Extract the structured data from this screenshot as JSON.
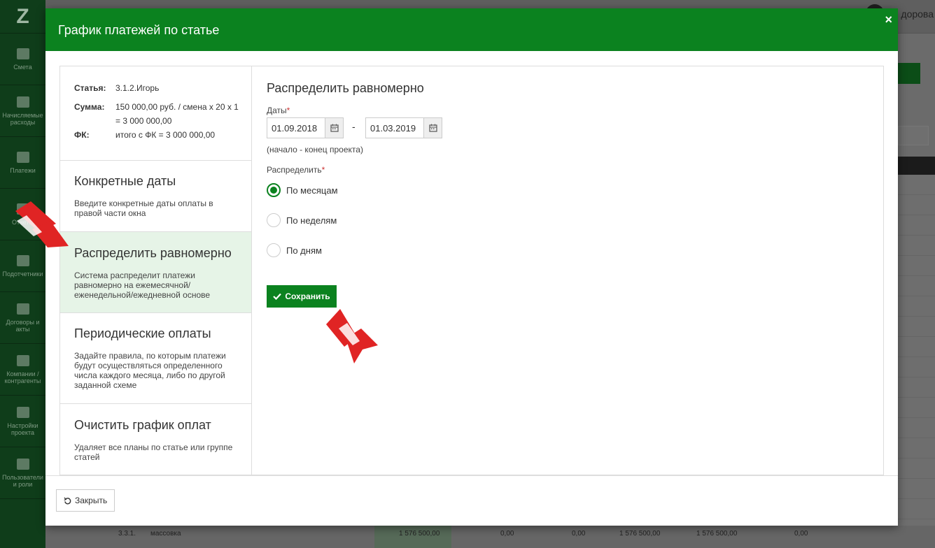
{
  "background": {
    "logo": "Z",
    "sidebar_items": [
      {
        "label": "Смета"
      },
      {
        "label": "Начисляемые расходы"
      },
      {
        "label": "Платежи"
      },
      {
        "label": "Отчеты"
      },
      {
        "label": "Подотчетники"
      },
      {
        "label": "Договоры и акты"
      },
      {
        "label": "Компании / контрагенты"
      },
      {
        "label": "Настройки проекта"
      },
      {
        "label": "Пользователи и роли"
      }
    ],
    "user_name": "дорова",
    "bottom_row": {
      "code": "3.3.1.",
      "name": "массовка",
      "v1": "1 576 500,00",
      "v2": "0,00",
      "v3": "0,00",
      "v4": "1 576 500,00",
      "v5": "1 576 500,00",
      "v6": "0,00"
    }
  },
  "modal": {
    "title": "График платежей по статье",
    "close_symbol": "×",
    "info": {
      "article_label": "Статья:",
      "article_value": "3.1.2.Игорь",
      "sum_label": "Сумма:",
      "sum_value": "150 000,00 руб. / смена х 20 х 1 = 3 000 000,00",
      "fk_label": "ФК:",
      "fk_value": "итого с ФК = 3 000 000,00"
    },
    "options": [
      {
        "title": "Конкретные даты",
        "desc": "Введите конкретные даты оплаты в правой части окна"
      },
      {
        "title": "Распределить равномерно",
        "desc": "Система распределит платежи равномерно на ежемесячной/ еженедельной/ежедневной основе"
      },
      {
        "title": "Периодические оплаты",
        "desc": "Задайте правила, по которым платежи будут осуществляться определенного числа каждого месяца, либо по другой заданной схеме"
      },
      {
        "title": "Очистить график оплат",
        "desc": "Удаляет все планы по статье или группе статей"
      }
    ],
    "form": {
      "heading": "Распределить равномерно",
      "dates_label": "Даты",
      "required_mark": "*",
      "date_from": "01.09.2018",
      "date_separator": "-",
      "date_to": "01.03.2019",
      "dates_hint": "(начало - конец проекта)",
      "distribute_label": "Распределить",
      "radios": [
        {
          "label": "По месяцам",
          "checked": true
        },
        {
          "label": "По неделям",
          "checked": false
        },
        {
          "label": "По дням",
          "checked": false
        }
      ],
      "save_label": "Сохранить"
    },
    "footer": {
      "close_label": "Закрыть"
    }
  },
  "colors": {
    "brand_green": "#0b821f",
    "active_option_bg": "#e6f4e7",
    "arrow_red": "#e02424"
  }
}
